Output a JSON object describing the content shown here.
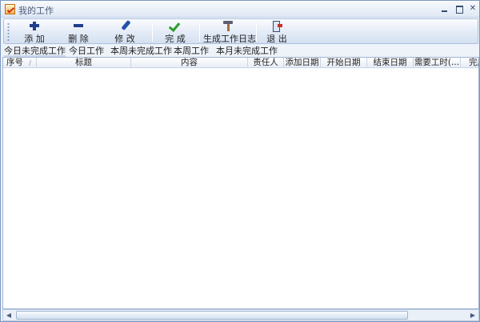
{
  "window": {
    "title": "我的工作"
  },
  "toolbar": {
    "buttons": [
      {
        "label": "添 加",
        "icon": "plus-icon"
      },
      {
        "label": "删 除",
        "icon": "minus-icon"
      },
      {
        "label": "修 改",
        "icon": "edit-icon"
      },
      {
        "label": "完 成",
        "icon": "check-icon"
      },
      {
        "label": "生成工作日志",
        "icon": "hammer-icon"
      },
      {
        "label": "退 出",
        "icon": "exit-icon"
      }
    ]
  },
  "tabs": [
    {
      "label": "今日未完成工作",
      "active": true
    },
    {
      "label": "今日工作"
    },
    {
      "label": "本周未完成工作"
    },
    {
      "label": "本周工作"
    },
    {
      "label": "本月未完成工作"
    }
  ],
  "grid": {
    "columns": [
      "序号",
      "标题",
      "内容",
      "责任人",
      "添加日期",
      "开始日期",
      "结束日期",
      "需要工时(...",
      "完成"
    ],
    "rows": []
  },
  "colors": {
    "frame": "#bfd3ee",
    "toolbar_border": "#aec2de",
    "check_green": "#2e9b2e",
    "icon_blue": "#1f3f8a"
  }
}
